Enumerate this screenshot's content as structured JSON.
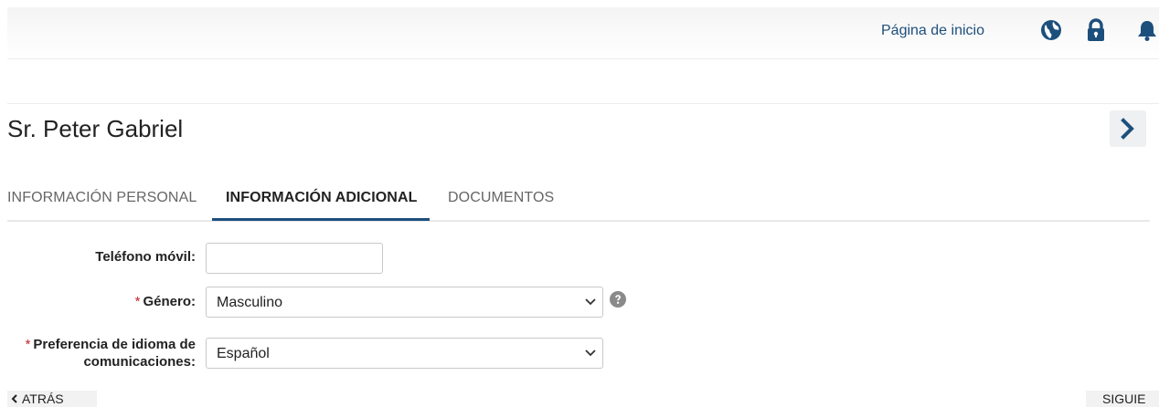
{
  "header": {
    "home_link": "Página de inicio",
    "icons": [
      "globe-icon",
      "lock-icon",
      "bell-icon"
    ]
  },
  "person": {
    "name": "Sr. Peter Gabriel"
  },
  "tabs": [
    {
      "label": "INFORMACIÓN PERSONAL",
      "active": false
    },
    {
      "label": "INFORMACIÓN ADICIONAL",
      "active": true
    },
    {
      "label": "DOCUMENTOS",
      "active": false
    }
  ],
  "form": {
    "mobile_phone": {
      "label": "Teléfono móvil:",
      "value": ""
    },
    "gender": {
      "required_mark": "*",
      "label": "Género:",
      "value": "Masculino"
    },
    "language_pref": {
      "required_mark": "*",
      "label_line1": "Preferencia de idioma de",
      "label_line2": "comunicaciones:",
      "value": "Español"
    }
  },
  "footer": {
    "back_label": "ATRÁS",
    "next_label": "SIGUIE"
  },
  "colors": {
    "accent": "#1d4f7c",
    "required": "#c0242b",
    "help_icon": "#8a8a8a"
  }
}
